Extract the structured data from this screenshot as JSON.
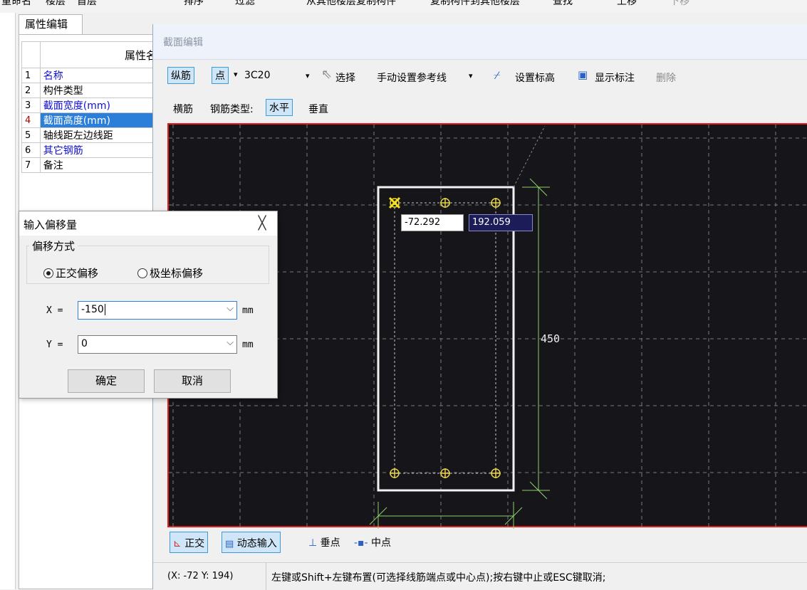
{
  "top_toolbar": {
    "items": [
      "重命名",
      "楼层",
      "首层",
      "排序",
      "过滤",
      "从其他楼层复制构件",
      "复制构件到其他楼层",
      "查找",
      "上移",
      "下移"
    ]
  },
  "property_panel": {
    "tab_label": "属性编辑",
    "header": "属性名",
    "rows": [
      {
        "num": "1",
        "name": "名称",
        "blue": true
      },
      {
        "num": "2",
        "name": "构件类型",
        "blue": false
      },
      {
        "num": "3",
        "name": "截面宽度(mm)",
        "blue": true
      },
      {
        "num": "4",
        "name": "截面高度(mm)",
        "blue": true
      },
      {
        "num": "5",
        "name": "轴线距左边线距",
        "blue": false
      },
      {
        "num": "6",
        "name": "其它钢筋",
        "blue": true
      },
      {
        "num": "7",
        "name": "备注",
        "blue": false
      }
    ],
    "selected_row": 4
  },
  "editor": {
    "title": "截面编辑",
    "toolbar1": {
      "longitudinal": "纵筋",
      "point": "点",
      "rebar_spec": "3C20",
      "select": "选择",
      "ref_line": "手动设置参考线",
      "set_elevation": "设置标高",
      "show_annotation": "显示标注",
      "delete": "删除"
    },
    "toolbar2": {
      "stirrup": "横筋",
      "rebar_type_label": "钢筋类型:",
      "horizontal": "水平",
      "vertical": "垂直"
    },
    "canvas": {
      "coord_x": "-72.292",
      "coord_y": "192.059",
      "dimension_height": "450"
    },
    "snap_bar": {
      "ortho": "正交",
      "dynamic_input": "动态输入",
      "perpendicular": "垂点",
      "midpoint": "中点"
    },
    "status": {
      "coords": "(X: -72 Y: 194)",
      "hint": "左键或Shift+左键布置(可选择线筋端点或中心点);按右键中止或ESC键取消;"
    }
  },
  "dialog": {
    "title": "输入偏移量",
    "close": "╳",
    "group_label": "偏移方式",
    "option_ortho": "正交偏移",
    "option_polar": "极坐标偏移",
    "x_label": "X =",
    "x_value": "-150",
    "y_label": "Y =",
    "y_value": "0",
    "unit": "mm",
    "ok": "确定",
    "cancel": "取消"
  },
  "colors": {
    "canvas_bg": "#15151a",
    "canvas_border": "#e02020",
    "rebar": "#e8d34a",
    "dimension": "#8fd06a",
    "selection_blue": "#2b7fd8"
  }
}
